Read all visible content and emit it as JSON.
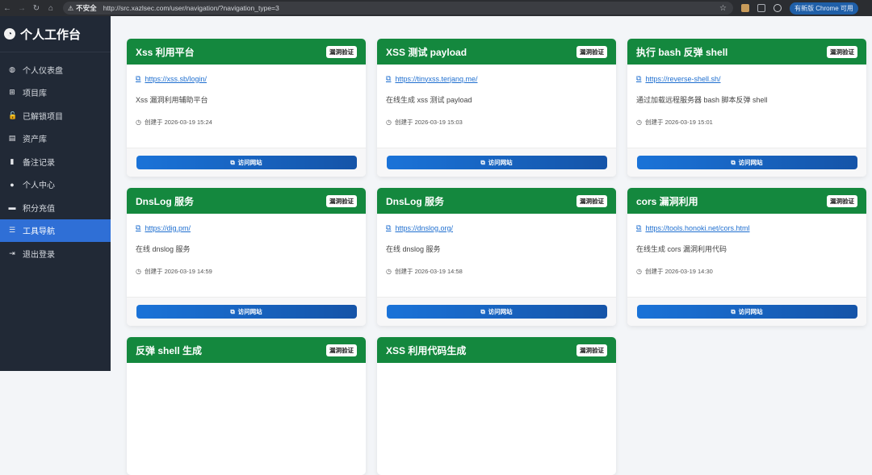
{
  "browser": {
    "back_icon": "arrow-left-icon",
    "forward_icon": "arrow-right-icon",
    "reload_icon": "reload-icon",
    "home_icon": "home-icon",
    "insecure_label": "不安全",
    "url": "http://src.xazlsec.com/user/navigation/?navigation_type=3",
    "update_label": "有新版 Chrome 可用"
  },
  "sidebar": {
    "brand_icon": "user-circle-icon",
    "brand_title": "个人工作台",
    "items": [
      {
        "label": "个人仪表盘",
        "icon": "dashboard-icon",
        "glyph": "◍"
      },
      {
        "label": "项目库",
        "icon": "grid-icon",
        "glyph": "⊞"
      },
      {
        "label": "已解锁项目",
        "icon": "unlock-icon",
        "glyph": "🔓"
      },
      {
        "label": "资产库",
        "icon": "server-icon",
        "glyph": "▤"
      },
      {
        "label": "备注记录",
        "icon": "note-icon",
        "glyph": "▮"
      },
      {
        "label": "个人中心",
        "icon": "user-icon",
        "glyph": "●"
      },
      {
        "label": "积分充值",
        "icon": "wallet-icon",
        "glyph": "▬"
      },
      {
        "label": "工具导航",
        "icon": "list-icon",
        "glyph": "☰",
        "active": true
      },
      {
        "label": "退出登录",
        "icon": "logout-icon",
        "glyph": "⇥"
      }
    ]
  },
  "accent_colors": {
    "card_header": "#14883e",
    "button": "#1a73d8",
    "sidebar_bg": "#212936",
    "sidebar_active": "#2f6fd6"
  },
  "cards": [
    {
      "title": "Xss 利用平台",
      "badge": "漏洞验证",
      "url": "https://xss.sb/login/",
      "desc": "Xss 漏洞利用辅助平台",
      "time": "创建于 2026-03-19 15:24",
      "button": "访问网站"
    },
    {
      "title": "XSS 测试 payload",
      "badge": "漏洞验证",
      "url": "https://tinyxss.terjanq.me/",
      "desc": "在线生成 xss 测试 payload",
      "time": "创建于 2026-03-19 15:03",
      "button": "访问网站"
    },
    {
      "title": "执行 bash 反弹 shell",
      "badge": "漏洞验证",
      "url": "https://reverse-shell.sh/",
      "desc": "通过加载远程服务器 bash 脚本反弹 shell",
      "time": "创建于 2026-03-19 15:01",
      "button": "访问网站"
    },
    {
      "title": "DnsLog 服务",
      "badge": "漏洞验证",
      "url": "https://dig.pm/",
      "desc": "在线 dnslog 服务",
      "time": "创建于 2026-03-19 14:59",
      "button": "访问网站"
    },
    {
      "title": "DnsLog 服务",
      "badge": "漏洞验证",
      "url": "https://dnslog.org/",
      "desc": "在线 dnslog 服务",
      "time": "创建于 2026-03-19 14:58",
      "button": "访问网站"
    },
    {
      "title": "cors 漏洞利用",
      "badge": "漏洞验证",
      "url": "https://tools.honoki.net/cors.html",
      "desc": "在线生成 cors 漏洞利用代码",
      "time": "创建于 2026-03-19 14:30",
      "button": "访问网站"
    },
    {
      "title": "反弹 shell 生成",
      "badge": "漏洞验证"
    },
    {
      "title": "XSS 利用代码生成",
      "badge": "漏洞验证"
    }
  ]
}
